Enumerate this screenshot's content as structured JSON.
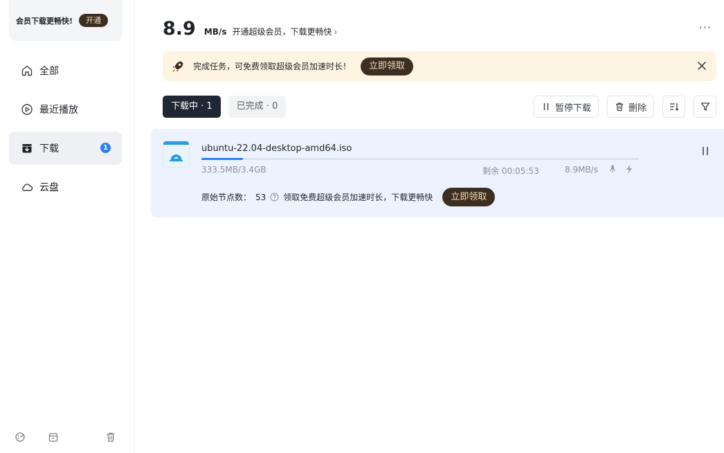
{
  "sidebar": {
    "vip_text": "会员下载更畅快!",
    "vip_button": "开通",
    "items": [
      {
        "label": "全部",
        "icon": "home-icon"
      },
      {
        "label": "最近播放",
        "icon": "play-circle-icon"
      },
      {
        "label": "下载",
        "icon": "download-box-icon",
        "badge": "1"
      },
      {
        "label": "云盘",
        "icon": "cloud-icon"
      }
    ],
    "bottom_icons": [
      "theme-icon",
      "archive-icon",
      "trash-icon"
    ]
  },
  "header": {
    "speed_value": "8.9",
    "speed_unit": "MB/s",
    "speed_promo": "开通超级会员，下载更畅快",
    "more": "···"
  },
  "banner": {
    "text": "完成任务，可免费领取超级会员加速时长！",
    "button": "立即领取"
  },
  "tabs": [
    {
      "label": "下载中 · 1",
      "active": true
    },
    {
      "label": "已完成 · 0",
      "active": false
    }
  ],
  "toolbar": {
    "pause_all": "暂停下载",
    "delete": "删除"
  },
  "task": {
    "file_name": "ubuntu-22.04-desktop-amd64.iso",
    "size": "333.5MB/3.4GB",
    "remaining": "剩余 00:05:53",
    "rate": "8.9MB/s",
    "progress": 0.095,
    "node_label": "原始节点数：",
    "node_count": "53",
    "node_promo": "领取免费超级会员加速时长，下载更畅快",
    "node_button": "立即领取"
  },
  "colors": {
    "accent": "#2a7ef7",
    "vip_button_bg": "#3d2e22",
    "vip_button_text": "#f5dcb8",
    "banner_bg": "#fdf4e1",
    "task_bg": "#edf3fe",
    "active_tab_bg": "#1f2734"
  }
}
